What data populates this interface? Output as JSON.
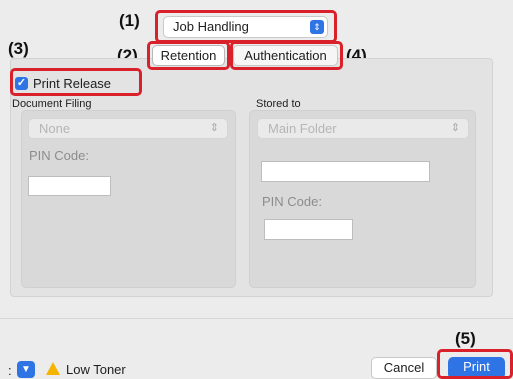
{
  "callouts": {
    "c1": "(1)",
    "c2": "(2)",
    "c3": "(3)",
    "c4": "(4)",
    "c5": "(5)"
  },
  "job_select": {
    "value": "Job Handling",
    "icon": "popup-arrows-icon"
  },
  "tabs": [
    {
      "label": "Retention",
      "active": true
    },
    {
      "label": "Authentication",
      "active": false
    }
  ],
  "print_release": {
    "label": "Print Release",
    "checked": true
  },
  "document_filing": {
    "label": "Document Filing",
    "select_value": "None",
    "pin_label": "PIN Code:",
    "pin_value": ""
  },
  "stored_to": {
    "label": "Stored to",
    "select_value": "Main Folder",
    "name_value": "",
    "pin_label": "PIN Code:",
    "pin_value": ""
  },
  "footer": {
    "left_glyph": ":",
    "warning_icon": "warning-icon",
    "warning_text": "Low Toner",
    "cancel_label": "Cancel",
    "print_label": "Print"
  },
  "colors": {
    "accent": "#2f74e5",
    "highlight": "#d9212c",
    "warning": "#f5b400"
  }
}
